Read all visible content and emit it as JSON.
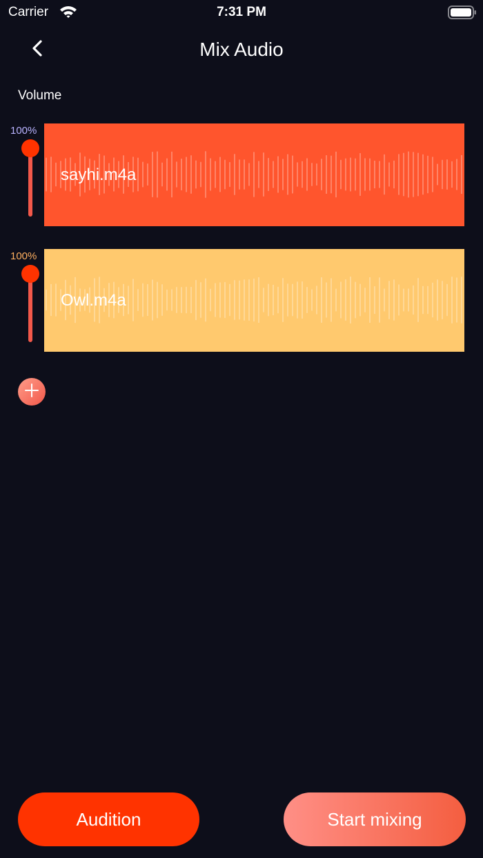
{
  "status_bar": {
    "carrier": "Carrier",
    "time": "7:31 PM",
    "wifi_icon": "wifi-icon",
    "battery_icon": "battery-icon"
  },
  "nav": {
    "title": "Mix Audio",
    "back_icon": "chevron-left-icon"
  },
  "section_label": "Volume",
  "tracks": [
    {
      "file_name": "sayhi.m4a",
      "volume_label": "100%",
      "volume_level": 1.0,
      "color": "#ff552d",
      "volume_label_color": "#b9b3ff"
    },
    {
      "file_name": "Owl.m4a",
      "volume_label": "100%",
      "volume_level": 1.0,
      "color": "#ffc96e",
      "volume_label_color": "#ffb060"
    }
  ],
  "colors": {
    "background": "#0d0e1a",
    "slider": "#ff3300",
    "accent": "#ff3300"
  },
  "add_button_icon": "plus-icon",
  "buttons": {
    "audition": "Audition",
    "start_mixing": "Start mixing"
  }
}
